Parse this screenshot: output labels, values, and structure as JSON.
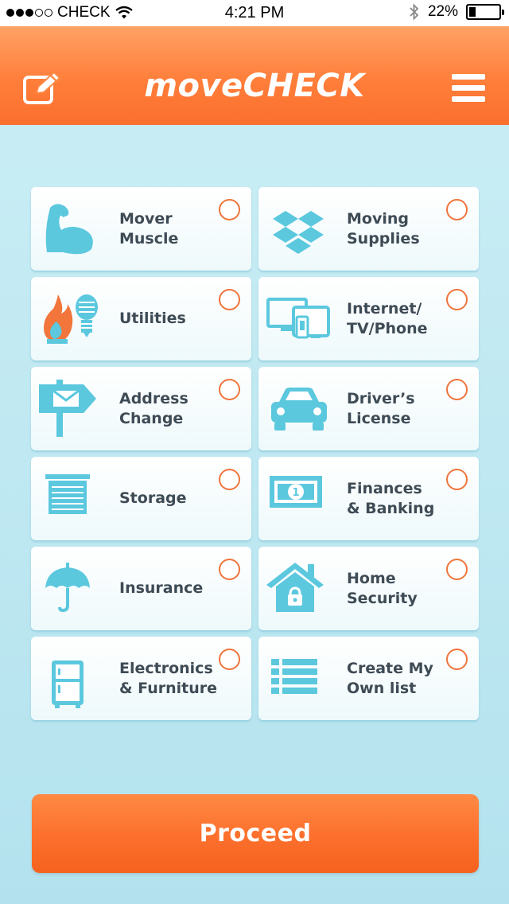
{
  "status_bar": {
    "carrier": "CHECK",
    "time": "4:21 PM",
    "battery": "22%",
    "battery_level": 0.22
  },
  "header": {
    "title": "moveCHECK",
    "left_icon": "edit-icon",
    "right_icon": "menu-icon"
  },
  "colors": {
    "accent": "#fb6f2e",
    "icon": "#5bc8de",
    "text": "#3e4b55",
    "background": "#c4eaf3"
  },
  "options": [
    {
      "label": "Mover\nMuscle",
      "icon": "muscle-icon",
      "selected": false
    },
    {
      "label": "Moving\nSupplies",
      "icon": "box-icon",
      "selected": false
    },
    {
      "label": "Utilities",
      "icon": "flame-bulb-icon",
      "selected": false
    },
    {
      "label": "Internet/\nTV/Phone",
      "icon": "devices-icon",
      "selected": false
    },
    {
      "label": "Address\nChange",
      "icon": "mailbox-sign-icon",
      "selected": false
    },
    {
      "label": "Driver’s\nLicense",
      "icon": "car-icon",
      "selected": false
    },
    {
      "label": "Storage",
      "icon": "storage-door-icon",
      "selected": false
    },
    {
      "label": "Finances\n& Banking",
      "icon": "banknote-icon",
      "selected": false
    },
    {
      "label": "Insurance",
      "icon": "umbrella-icon",
      "selected": false
    },
    {
      "label": "Home\nSecurity",
      "icon": "house-lock-icon",
      "selected": false
    },
    {
      "label": "Electronics\n& Furniture",
      "icon": "fridge-icon",
      "selected": false
    },
    {
      "label": "Create My\nOwn list",
      "icon": "list-icon",
      "selected": false
    }
  ],
  "proceed_label": "Proceed"
}
